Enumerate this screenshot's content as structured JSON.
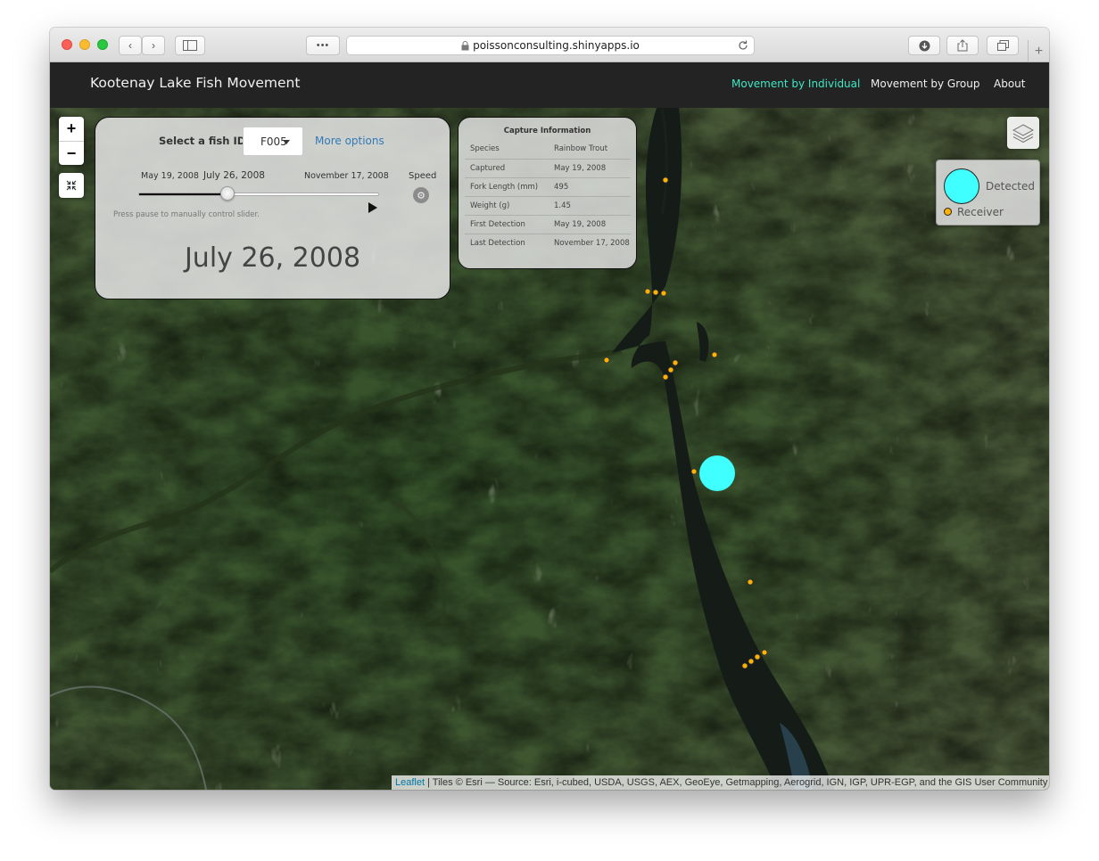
{
  "browser": {
    "url": "poissonconsulting.shinyapps.io",
    "more_label": "•••"
  },
  "navbar": {
    "brand": "Kootenay Lake Fish Movement",
    "links": [
      {
        "label": "Movement by Individual",
        "active": true
      },
      {
        "label": "Movement by Group",
        "active": false
      },
      {
        "label": "About",
        "active": false
      }
    ],
    "active_color": "#3de8c4"
  },
  "map_controls": {
    "zoom_in": "+",
    "zoom_out": "−",
    "fullscreen_icon": "collapse-arrows-icon",
    "layers_icon": "layers-icon"
  },
  "fish_panel": {
    "select_label": "Select a fish ID:",
    "fish_id": "F005",
    "more_options": "More options",
    "slider": {
      "min_label": "May 19, 2008",
      "current_label": "July 26, 2008",
      "max_label": "November 17, 2008",
      "progress": 0.37
    },
    "speed_label": "Speed",
    "hint": "Press pause to manually control slider.",
    "current_date": "July 26, 2008"
  },
  "capture_info": {
    "title": "Capture Information",
    "rows": [
      {
        "label": "Species",
        "value": "Rainbow Trout"
      },
      {
        "label": "Captured",
        "value": "May 19, 2008"
      },
      {
        "label": "Fork Length (mm)",
        "value": "495"
      },
      {
        "label": "Weight (g)",
        "value": "1.45"
      },
      {
        "label": "First Detection",
        "value": "May 19, 2008"
      },
      {
        "label": "Last Detection",
        "value": "November 17, 2008"
      }
    ]
  },
  "legend": {
    "detected_label": "Detected",
    "receiver_label": "Receiver",
    "detected_color": "#3fffff",
    "receiver_color": "#ffb000"
  },
  "attribution": {
    "leaflet": "Leaflet",
    "tiles": " | Tiles © Esri — Source: Esri, i-cubed, USDA, USGS, AEX, GeoEye, Getmapping, Aerogrid, IGN, IGP, UPR-EGP, and the GIS User Community"
  }
}
